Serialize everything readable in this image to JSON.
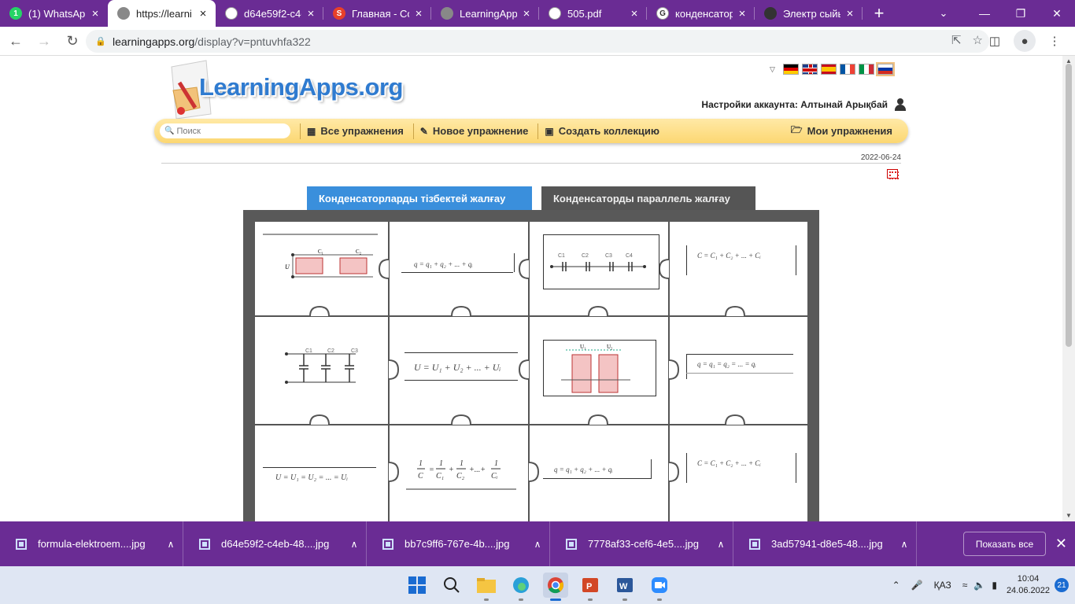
{
  "browser": {
    "tabs": [
      {
        "title": "(1) WhatsApp",
        "icon": "whatsapp-icon",
        "color": "#25d366",
        "glyph": "1"
      },
      {
        "title": "https://learni",
        "icon": "learningapps-favicon",
        "color": "#888888",
        "glyph": ""
      },
      {
        "title": "d64e59f2-c4e",
        "icon": "globe-icon",
        "color": "#ffffff",
        "glyph": ""
      },
      {
        "title": "Главная - Со",
        "icon": "s-brand-icon",
        "color": "#e8402a",
        "glyph": "S"
      },
      {
        "title": "LearningApps",
        "icon": "learningapps-favicon",
        "color": "#888888",
        "glyph": ""
      },
      {
        "title": "505.pdf",
        "icon": "globe-icon",
        "color": "#ffffff",
        "glyph": ""
      },
      {
        "title": "конденсатор",
        "icon": "google-icon",
        "color": "#ffffff",
        "glyph": "G"
      },
      {
        "title": "Электр сыйы",
        "icon": "document-icon",
        "color": "#333333",
        "glyph": ""
      }
    ],
    "url_host": "learningapps.org",
    "url_path": "/display?v=pntuvhfa322"
  },
  "site": {
    "logo_text": "LearningApps.org",
    "account_label": "Настройки аккаунта: Алтынай Арықбай",
    "search_placeholder": "Поиск",
    "nav": {
      "all_exercises": "Все упражнения",
      "new_exercise": "Новое упражнение",
      "create_collection": "Создать коллекцию",
      "my_exercises": "Мои упражнения"
    },
    "date": "2022-06-24",
    "app_tabs": {
      "series": "Конденсаторларды тізбектей жалғау",
      "parallel": "Конденсаторды параллель жалғау"
    }
  },
  "puzzle": {
    "formulas": {
      "r0c1": "q = q₁ + q₂ + ... + qᵢ",
      "r0c3": "C = C₁ + C₂ + ... + Cᵢ",
      "r1c1": "U = U₁ + U₂ + ... + Uᵢ",
      "r1c3": "q = q₁ = q₂ = ... = qᵢ",
      "r2c0": "U = U₁ = U₂ = ... = Uᵢ",
      "r2c2": "q = q₁ + q₂ + ... + qᵢ",
      "r2c3": "C = C₁ + C₂ + ... + Cᵢ"
    },
    "labels": {
      "c1": "C1",
      "c2": "C2",
      "c3": "C3",
      "c4": "C4",
      "u": "U",
      "u1": "U₁",
      "u2": "U₂"
    }
  },
  "downloads": {
    "items": [
      "formula-elektroem....jpg",
      "d64e59f2-c4eb-48....jpg",
      "bb7c9ff6-767e-4b....jpg",
      "7778af33-cef6-4e5....jpg",
      "3ad57941-d8e5-48....jpg"
    ],
    "show_all": "Показать все"
  },
  "taskbar": {
    "lang": "ҚАЗ",
    "time": "10:04",
    "date": "24.06.2022",
    "notifications": "21"
  }
}
